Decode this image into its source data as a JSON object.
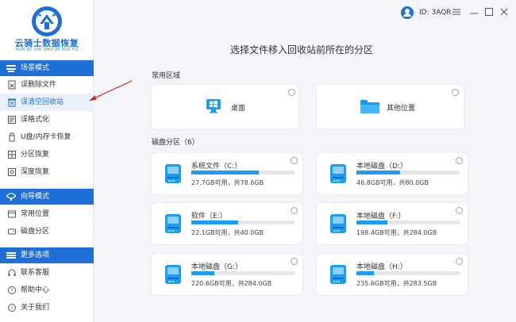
{
  "app": {
    "logo_title": "云骑士数据恢复",
    "logo_subtitle": "YUN QI SHI SHU JU HUI FU"
  },
  "user": {
    "id_text": "ID: 3AQR"
  },
  "sidebar": {
    "sections": [
      {
        "title": "场景模式",
        "items": [
          {
            "label": "误删除文件",
            "icon": "file-delete-icon",
            "active": false
          },
          {
            "label": "误清空回收站",
            "icon": "recycle-bin-icon",
            "active": true
          },
          {
            "label": "误格式化",
            "icon": "format-icon",
            "active": false
          },
          {
            "label": "U盘/内存卡恢复",
            "icon": "usb-icon",
            "active": false
          },
          {
            "label": "分区恢复",
            "icon": "partition-icon",
            "active": false
          },
          {
            "label": "深度恢复",
            "icon": "deep-scan-icon",
            "active": false
          }
        ]
      },
      {
        "title": "向导模式",
        "items": [
          {
            "label": "常用位置",
            "icon": "location-icon",
            "active": false
          },
          {
            "label": "磁盘分区",
            "icon": "disk-partition-icon",
            "active": false
          }
        ]
      },
      {
        "title": "更多选项",
        "items": [
          {
            "label": "联系客服",
            "icon": "headset-icon",
            "active": false
          },
          {
            "label": "帮助中心",
            "icon": "help-icon",
            "active": false
          },
          {
            "label": "关于我们",
            "icon": "info-icon",
            "active": false
          }
        ]
      }
    ]
  },
  "main": {
    "headline": "选择文件移入回收站前所在的分区",
    "common_label": "常用区域",
    "common_items": [
      {
        "name": "桌面",
        "icon": "desktop-icon"
      },
      {
        "name": "其他位置",
        "icon": "folder-icon"
      }
    ],
    "disk_label": "磁盘分区（6）",
    "drives": [
      {
        "name": "系统文件（C:）",
        "size_text": "27.7GB可用，共78.6GB",
        "used_fraction": 0.65
      },
      {
        "name": "本地磁盘（D:）",
        "size_text": "46.8GB可用，共80.0GB",
        "used_fraction": 0.42
      },
      {
        "name": "软件（E:）",
        "size_text": "22.1GB可用，共40.0GB",
        "used_fraction": 0.45
      },
      {
        "name": "本地磁盘（F:）",
        "size_text": "198.4GB可用，共284.0GB",
        "used_fraction": 0.3
      },
      {
        "name": "本地磁盘（G:）",
        "size_text": "220.6GB可用，共284.0GB",
        "used_fraction": 0.22
      },
      {
        "name": "本地磁盘（H:）",
        "size_text": "235.6GB可用，共283.5GB",
        "used_fraction": 0.17
      }
    ]
  },
  "colors": {
    "accent": "#1e6fd8",
    "bar_fill": "#1a9ef5",
    "bar_track": "#e3e6eb",
    "annotation_arrow": "#d9221c"
  }
}
